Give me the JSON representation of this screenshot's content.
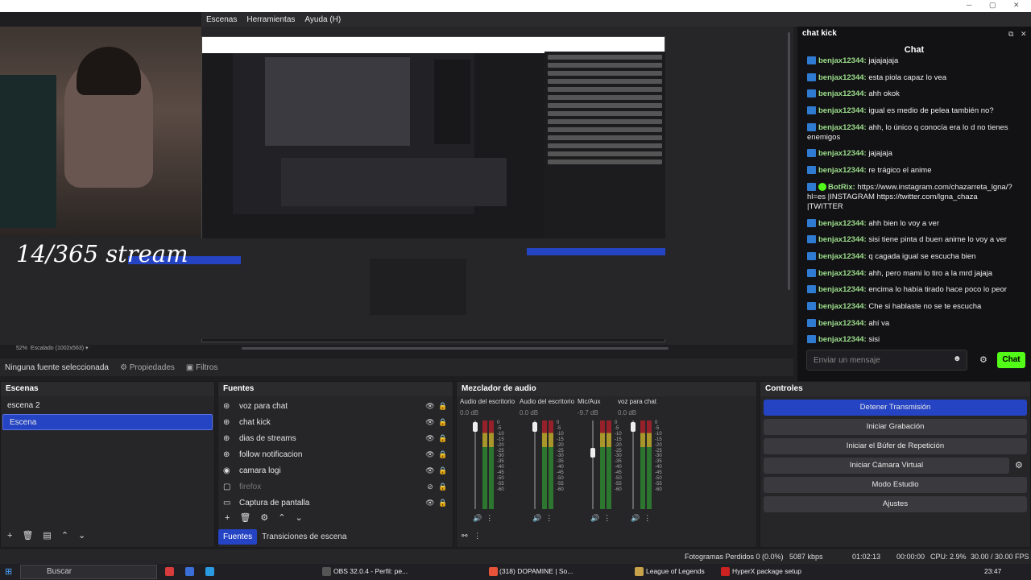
{
  "menu": {
    "items": [
      "Escenas",
      "Herramientas",
      "Ayuda (H)"
    ]
  },
  "overlay_text": "14/365 stream",
  "preview": {
    "zoom": "52%",
    "scale": "Escalado (1002x563)"
  },
  "chat": {
    "panel_title": "chat kick",
    "title": "Chat",
    "input_placeholder": "Enviar un mensaje",
    "send_label": "Chat",
    "messages": [
      {
        "user": "benjax12344:",
        "text": "jajajajaja"
      },
      {
        "user": "benjax12344:",
        "text": "esta piola capaz lo vea"
      },
      {
        "user": "benjax12344:",
        "text": "ahh okok"
      },
      {
        "user": "benjax12344:",
        "text": "igual es medio de pelea también no?"
      },
      {
        "user": "benjax12344:",
        "text": "ahh, lo único q conocía era lo d no tienes enemigos"
      },
      {
        "user": "benjax12344:",
        "text": "jajajaja"
      },
      {
        "user": "benjax12344:",
        "text": "re trágico el anime"
      },
      {
        "user": "BotRix:",
        "text": "https://www.instagram.com/chazarreta_lgna/?hl=es |INSTAGRAM https://twitter.com/lgna_chaza |TWITTER"
      },
      {
        "user": "benjax12344:",
        "text": "ahh bien lo voy a ver"
      },
      {
        "user": "benjax12344:",
        "text": "sisi tiene pinta d buen anime lo voy a ver"
      },
      {
        "user": "benjax12344:",
        "text": "q cagada igual se escucha bien"
      },
      {
        "user": "benjax12344:",
        "text": "ahh, pero mami lo tiro a la mrd jajaja"
      },
      {
        "user": "benjax12344:",
        "text": "encima lo había tirado hace poco lo peor"
      },
      {
        "user": "benjax12344:",
        "text": "Che si hablaste no se te escucha"
      },
      {
        "user": "benjax12344:",
        "text": "ahí va"
      },
      {
        "user": "benjax12344:",
        "text": "sisi"
      }
    ]
  },
  "props": {
    "none": "Ninguna fuente seleccionada",
    "properties": "Propiedades",
    "filters": "Filtros"
  },
  "scenes": {
    "title": "Escenas",
    "items": [
      "escena 2",
      "Escena"
    ]
  },
  "sources": {
    "title": "Fuentes",
    "items": [
      {
        "label": "voz para chat",
        "icon": "mic-icon"
      },
      {
        "label": "chat kick",
        "icon": "globe-icon"
      },
      {
        "label": "dias de streams",
        "icon": "globe-icon"
      },
      {
        "label": "follow notificacion",
        "icon": "globe-icon"
      },
      {
        "label": "camara logi",
        "icon": "camera-icon"
      },
      {
        "label": "firefox",
        "icon": "window-icon"
      },
      {
        "label": "Captura de pantalla",
        "icon": "monitor-icon"
      }
    ],
    "tab_sources": "Fuentes",
    "tab_transitions": "Transiciones de escena"
  },
  "mixer": {
    "title": "Mezclador de audio",
    "channels": [
      {
        "name": "Audio del escritorio",
        "db": "0.0 dB"
      },
      {
        "name": "Audio del escritorio",
        "db": "0.0 dB"
      },
      {
        "name": "Mic/Aux",
        "db": "-9.7 dB"
      },
      {
        "name": "voz para chat",
        "db": "0.0 dB"
      }
    ],
    "scale": [
      "0",
      "-5",
      "-10",
      "-15",
      "-20",
      "-25",
      "-30",
      "-35",
      "-40",
      "-45",
      "-50",
      "-55",
      "-60"
    ]
  },
  "controls": {
    "title": "Controles",
    "buttons": [
      "Detener Transmisión",
      "Iniciar Grabación",
      "Iniciar el Búfer de Repetición",
      "Iniciar Cámara Virtual",
      "Modo Estudio",
      "Ajustes"
    ]
  },
  "status": {
    "dropped": "Fotogramas Perdidos 0 (0.0%)",
    "bitrate": "5087 kbps",
    "live": "01:02:13",
    "rec": "00:00:00",
    "cpu": "CPU: 2.9%",
    "fps": "30.00 / 30.00 FPS"
  },
  "taskbar": {
    "search": "Buscar",
    "obs": "OBS 32.0.4 - Perfil: pe...",
    "yt": "(318) DOPAMINE | So...",
    "lol": "League of Legends",
    "hyperx": "HyperX package setup",
    "time": "23:47"
  },
  "colors": {
    "accent": "#2544c4",
    "kick": "#53fc18"
  }
}
